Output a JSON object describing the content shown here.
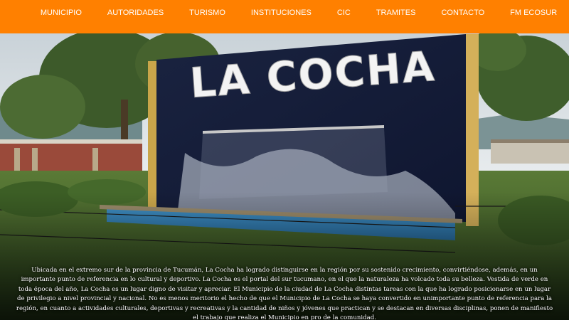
{
  "nav": {
    "items": [
      {
        "label": "MUNICIPIO"
      },
      {
        "label": "AUTORIDADES"
      },
      {
        "label": "TURISMO"
      },
      {
        "label": "INSTITUCIONES"
      },
      {
        "label": "CIC"
      },
      {
        "label": "TRAMITES"
      },
      {
        "label": "CONTACTO"
      },
      {
        "label": "FM ECOSUR"
      }
    ],
    "bar_color": "#ff8000"
  },
  "hero": {
    "sign_text": "LA COCHA",
    "photo_alt": "La Cocha welcome monument with fountain"
  },
  "caption": {
    "text": "Ubicada en el extremo sur de la provincia de Tucumán, La Cocha ha logrado distinguirse en la región por su sostenido crecimiento, convirtiéndose, además, en un importante punto de referencia en lo cultural y deportivo. La Cocha es el portal del sur tucumano, en el que la naturaleza ha volcado toda su belleza. Vestida de verde en toda época del año, La Cocha es un lugar digno de visitar y apreciar. El Municipio de la ciudad de La Cocha distintas tareas con la que ha logrado posicionarse en un lugar de privilegio a nivel provincial y nacional. No es menos meritorio el hecho de que el Municipio de La Cocha se haya convertido en unimportante punto de referencia para la región, en cuanto a actividades culturales, deportivas y recreativas y la cantidad de niños y jóvenes que practican y se destacan en diversas disciplinas, ponen de manifiesto el trabajo que realiza el Municipio en pro de la comunidad."
  }
}
